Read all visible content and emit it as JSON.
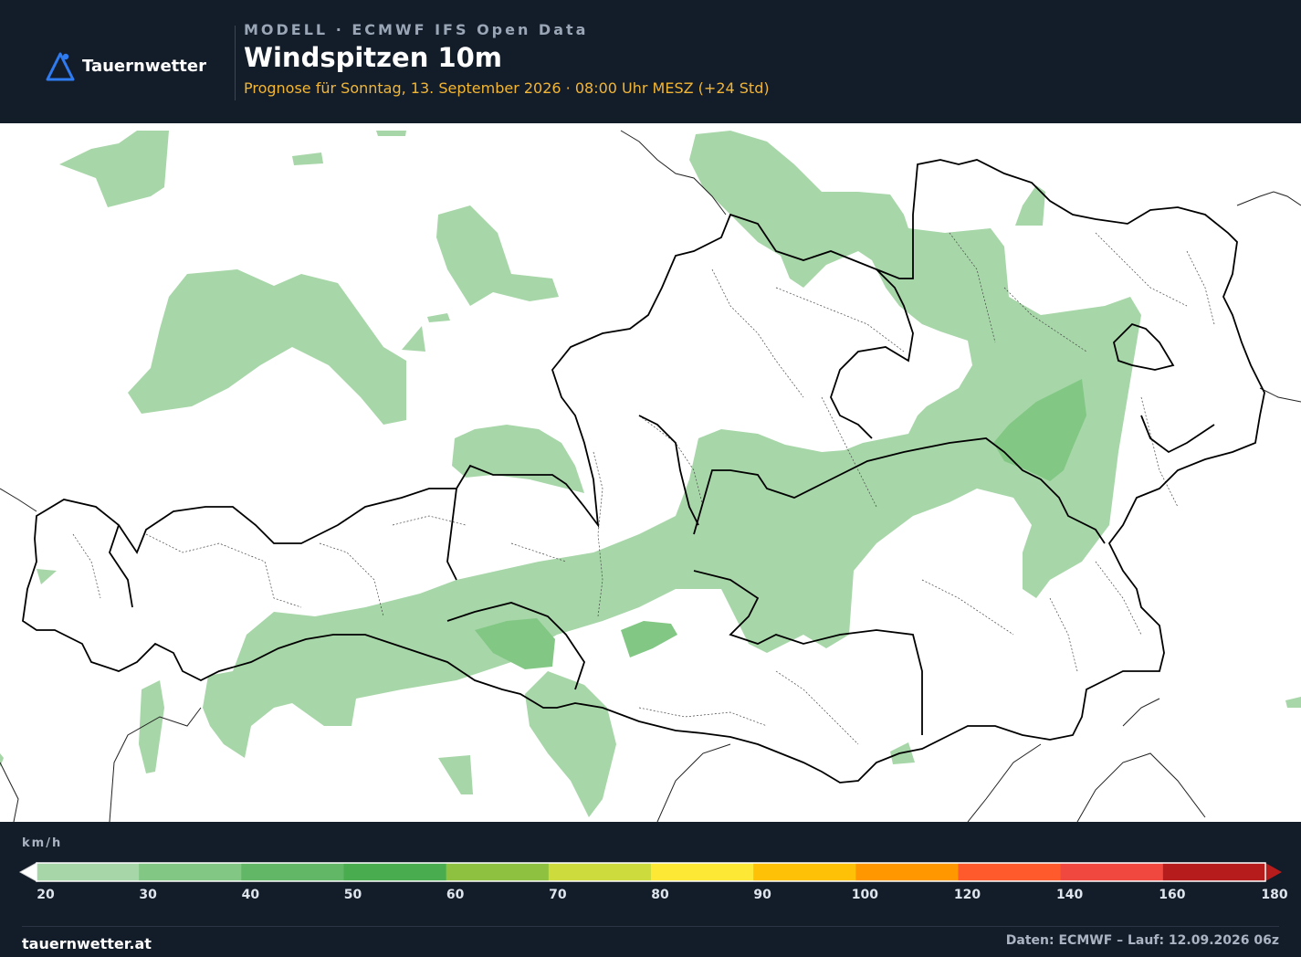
{
  "brand": {
    "name": "Tauernwetter",
    "logo_icon": "mountain-pin-icon",
    "accent": "#2f7bf0"
  },
  "header": {
    "model_line": "MODELL · ECMWF IFS Open Data",
    "title": "Windspitzen 10m",
    "subtitle": "Prognose für Sonntag, 13. September 2026 · 08:00 Uhr MESZ  (+24 Std)"
  },
  "legend": {
    "unit": "km/h",
    "ticks": [
      "20",
      "30",
      "40",
      "50",
      "60",
      "70",
      "80",
      "90",
      "100",
      "120",
      "140",
      "160",
      "180"
    ],
    "colors": [
      "#a7d6a8",
      "#82c784",
      "#62b766",
      "#49ad4f",
      "#8dc13f",
      "#cddb3c",
      "#fde835",
      "#ffc107",
      "#ff9800",
      "#ff5a2c",
      "#f0473f",
      "#b71c1c"
    ],
    "underflow_color": "#ffffff",
    "overflow_color": "#b71c1c"
  },
  "map": {
    "background": "#ffffff",
    "fill_levels": [
      "#a7d6a8",
      "#82c784"
    ],
    "border_color": "#000000"
  },
  "footer": {
    "site": "tauernwetter.at",
    "data_note": "Daten: ECMWF – Lauf: 12.09.2026 06z"
  }
}
